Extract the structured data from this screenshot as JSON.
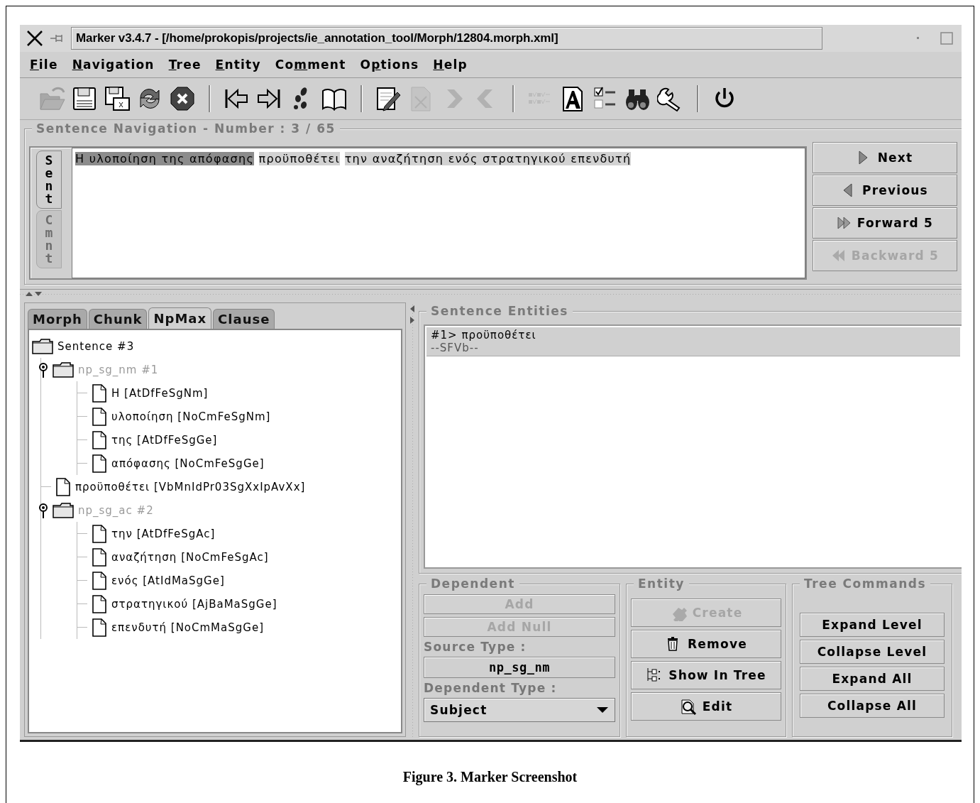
{
  "window": {
    "title": "Marker v3.4.7 - [/home/prokopis/projects/ie_annotation_tool/Morph/12804.morph.xml]"
  },
  "menu": [
    {
      "key": "F",
      "after": "ile"
    },
    {
      "key": "N",
      "after": "avigation"
    },
    {
      "key": "T",
      "after": "ree"
    },
    {
      "key": "E",
      "after": "ntity"
    },
    {
      "before": "Co",
      "key": "m",
      "after": "ment"
    },
    {
      "before": "O",
      "key": "p",
      "after": "tions"
    },
    {
      "key": "H",
      "after": "elp"
    }
  ],
  "toolbar": [
    {
      "kind": "open",
      "disabled": true
    },
    {
      "kind": "save",
      "disabled": false
    },
    {
      "kind": "save-as",
      "disabled": false
    },
    {
      "kind": "refresh",
      "disabled": false
    },
    {
      "kind": "stop",
      "disabled": false
    },
    {
      "kind": "separator"
    },
    {
      "kind": "first",
      "disabled": false
    },
    {
      "kind": "last",
      "disabled": false
    },
    {
      "kind": "footprints",
      "disabled": false
    },
    {
      "kind": "book",
      "disabled": false
    },
    {
      "kind": "separator"
    },
    {
      "kind": "edit",
      "disabled": false
    },
    {
      "kind": "delete",
      "disabled": true
    },
    {
      "kind": "forward",
      "disabled": true
    },
    {
      "kind": "back",
      "disabled": true
    },
    {
      "kind": "separator"
    },
    {
      "kind": "pattern",
      "disabled": true
    },
    {
      "kind": "font",
      "disabled": false
    },
    {
      "kind": "checklist",
      "disabled": false
    },
    {
      "kind": "binoculars",
      "disabled": false
    },
    {
      "kind": "wrench",
      "disabled": false
    },
    {
      "kind": "separator"
    },
    {
      "kind": "power",
      "disabled": false
    }
  ],
  "sentence_navigation": {
    "title": "Sentence Navigation - Number :  3 / 65",
    "side_tabs": [
      {
        "label": "Sent",
        "selected": true
      },
      {
        "label": "Cmnt",
        "selected": false
      }
    ],
    "sentence": [
      {
        "text": "Η υλοποίηση της απόφασης",
        "selected": true
      },
      {
        "text": "προϋποθέτει",
        "selected": false
      },
      {
        "text": "την αναζήτηση ενός στρατηγικού επενδυτή",
        "selected": false
      }
    ],
    "buttons": [
      {
        "label": "Next",
        "kind": "next",
        "disabled": false
      },
      {
        "label": "Previous",
        "kind": "previous",
        "disabled": false
      },
      {
        "label": "Forward 5",
        "kind": "forward",
        "disabled": false
      },
      {
        "label": "Backward 5",
        "kind": "backward",
        "disabled": true
      }
    ]
  },
  "view_tabs": [
    {
      "label": "Morph",
      "selected": false
    },
    {
      "label": "Chunk",
      "selected": false
    },
    {
      "label": "NpMax",
      "selected": true
    },
    {
      "label": "Clause",
      "selected": false
    }
  ],
  "tree": {
    "label": "Sentence #3",
    "kind": "root",
    "children": [
      {
        "label": "np_sg_nm #1",
        "kind": "group",
        "expanded": true,
        "children": [
          {
            "label": "Η  [AtDfFeSgNm]",
            "kind": "leaf"
          },
          {
            "label": "υλοποίηση  [NoCmFeSgNm]",
            "kind": "leaf"
          },
          {
            "label": "της  [AtDfFeSgGe]",
            "kind": "leaf"
          },
          {
            "label": "απόφασης  [NoCmFeSgGe]",
            "kind": "leaf"
          }
        ]
      },
      {
        "label": "προϋποθέτει  [VbMnIdPr03SgXxIpAvXx]",
        "kind": "leaf"
      },
      {
        "label": "np_sg_ac #2",
        "kind": "group",
        "expanded": true,
        "children": [
          {
            "label": "την  [AtDfFeSgAc]",
            "kind": "leaf"
          },
          {
            "label": "αναζήτηση  [NoCmFeSgAc]",
            "kind": "leaf"
          },
          {
            "label": "ενός  [AtIdMaSgGe]",
            "kind": "leaf"
          },
          {
            "label": "στρατηγικού  [AjBaMaSgGe]",
            "kind": "leaf"
          },
          {
            "label": "επενδυτή  [NoCmMaSgGe]",
            "kind": "leaf"
          }
        ]
      }
    ]
  },
  "sentence_entities": {
    "title": "Sentence Entities",
    "items": [
      {
        "lines": [
          "#1> προϋποθέτει",
          "--SFVb--"
        ],
        "selected": true
      }
    ]
  },
  "dependent": {
    "title": "Dependent",
    "buttons": [
      {
        "label": "Add",
        "disabled": true
      },
      {
        "label": "Add Null",
        "disabled": true
      }
    ],
    "source_type_label": "Source Type :",
    "source_type": "np_sg_nm",
    "dependent_type_label": "Dependent Type :",
    "dependent_type": "Subject"
  },
  "entity": {
    "title": "Entity",
    "buttons": [
      {
        "label": "Create",
        "kind": "create",
        "disabled": true
      },
      {
        "label": "Remove",
        "kind": "remove",
        "disabled": false
      },
      {
        "label": "Show In Tree",
        "kind": "show",
        "disabled": false
      },
      {
        "label": "Edit",
        "kind": "edit",
        "disabled": false
      }
    ]
  },
  "tree_commands": {
    "title": "Tree Commands",
    "buttons": [
      "Expand Level",
      "Collapse Level",
      "Expand All",
      "Collapse All"
    ]
  },
  "caption": "Figure 3. Marker Screenshot"
}
